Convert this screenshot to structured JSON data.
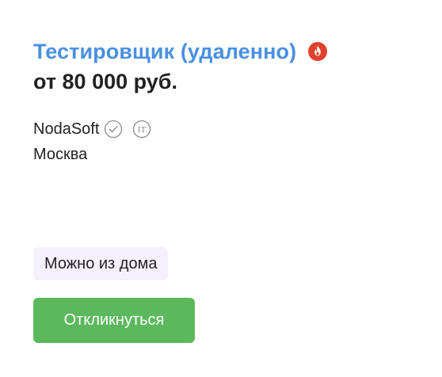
{
  "vacancy": {
    "title": "Тестировщик (удаленно)",
    "salary": "от 80 000 руб.",
    "hot_icon": "fire-icon",
    "company": "NodaSoft",
    "verified_icon": "verified-check-icon",
    "it_icon": "it-accredited-icon",
    "it_icon_text": "IT",
    "city": "Москва",
    "tag": "Можно из дома",
    "respond_label": "Откликнуться"
  },
  "colors": {
    "title": "#4a90e2",
    "hot": "#e2412e",
    "button": "#5cb85c",
    "tag_bg": "#f5f0fc",
    "icon_gray": "#8a8a8a"
  }
}
